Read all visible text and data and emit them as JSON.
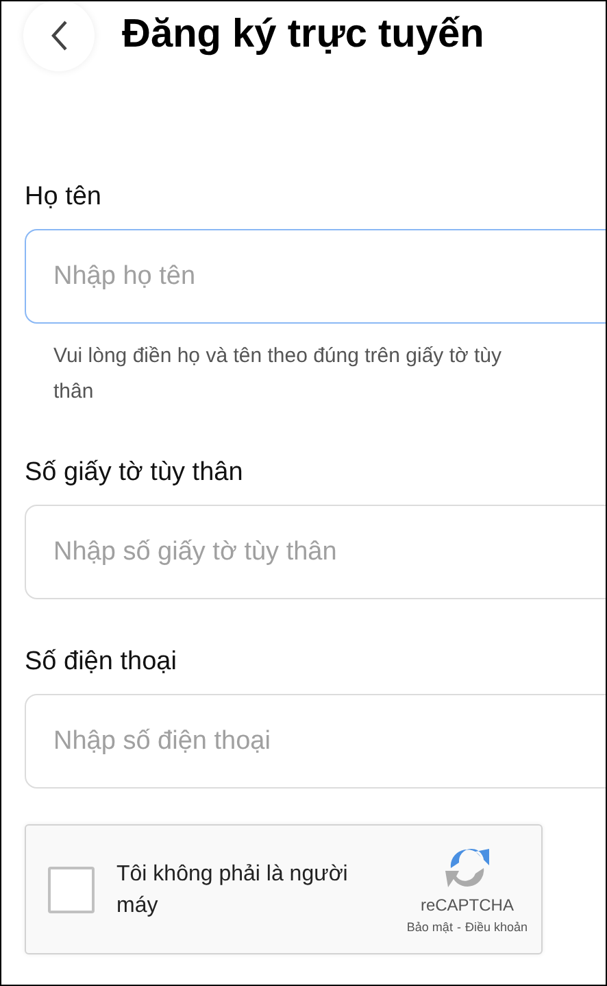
{
  "header": {
    "title": "Đăng ký trực tuyến"
  },
  "fields": [
    {
      "label": "Họ tên",
      "placeholder": "Nhập họ tên",
      "focused": true,
      "helper": "Vui lòng điền họ và tên theo đúng trên giấy tờ tùy thân"
    },
    {
      "label": "Số giấy tờ tùy thân",
      "placeholder": "Nhập số giấy tờ tùy thân",
      "focused": false
    },
    {
      "label": "Số điện thoại",
      "placeholder": "Nhập số điện thoại",
      "focused": false
    }
  ],
  "captcha": {
    "checked": false,
    "text": "Tôi không phải là người máy",
    "brand": "reCAPTCHA",
    "privacy": "Bảo mật",
    "separator": "-",
    "terms": "Điều khoản"
  }
}
